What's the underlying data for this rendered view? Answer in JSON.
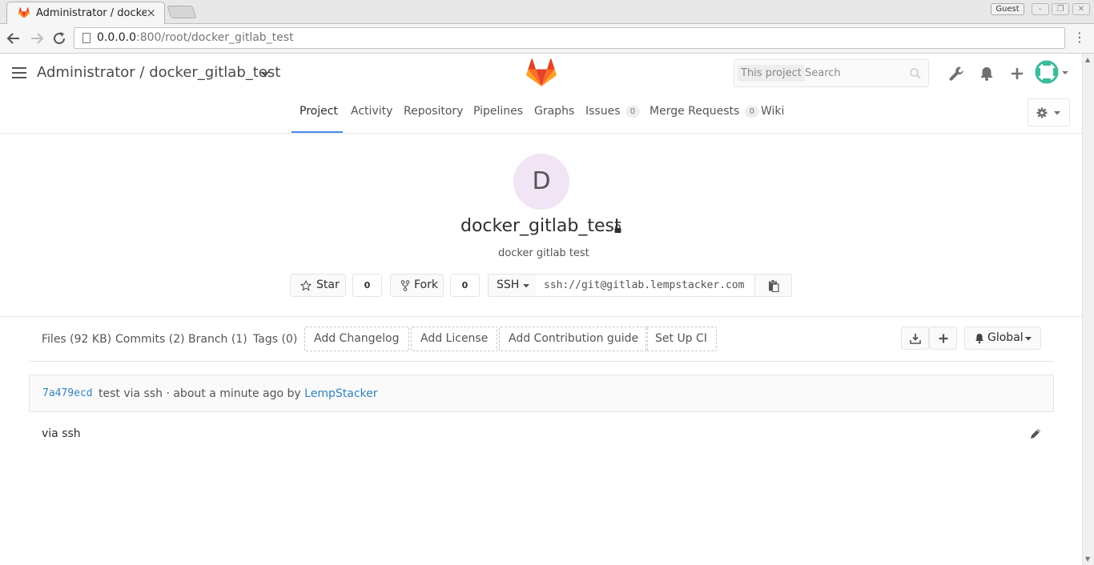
{
  "browser": {
    "tab_title": "Administrator / docker_gitlab_test",
    "guest_label": "Guest",
    "url_host": "0.0.0.0",
    "url_rest": ":800/root/docker_gitlab_test"
  },
  "header": {
    "breadcrumb": "Administrator / docker_gitlab_test",
    "search_scope": "This project",
    "search_placeholder": "Search"
  },
  "nav": {
    "tabs": [
      {
        "label": "Project"
      },
      {
        "label": "Activity"
      },
      {
        "label": "Repository"
      },
      {
        "label": "Pipelines"
      },
      {
        "label": "Graphs"
      },
      {
        "label": "Issues",
        "count": "0"
      },
      {
        "label": "Merge Requests",
        "count": "0"
      },
      {
        "label": "Wiki"
      }
    ]
  },
  "project": {
    "avatar_letter": "D",
    "name": "docker_gitlab_test",
    "description": "docker gitlab test",
    "star_label": "Star",
    "star_count": "0",
    "fork_label": "Fork",
    "fork_count": "0",
    "protocol": "SSH",
    "clone_url": "ssh://git@gitlab.lempstacker.com"
  },
  "stats": {
    "files": "Files (92 KB)",
    "commits": "Commits (2)",
    "branch": "Branch (1)",
    "tags": "Tags (0)",
    "add_changelog": "Add Changelog",
    "add_license": "Add License",
    "add_contribution": "Add Contribution guide",
    "setup_ci": "Set Up CI",
    "notification": "Global"
  },
  "commit": {
    "sha": "7a479ecd",
    "message": "test via ssh · about a minute ago by",
    "author": "LempStacker"
  },
  "readme": {
    "text": "via ssh"
  },
  "colors": {
    "link": "#3084bb",
    "active_tab": "#4a8bee",
    "avatar_bg": "#f1e4f4"
  }
}
